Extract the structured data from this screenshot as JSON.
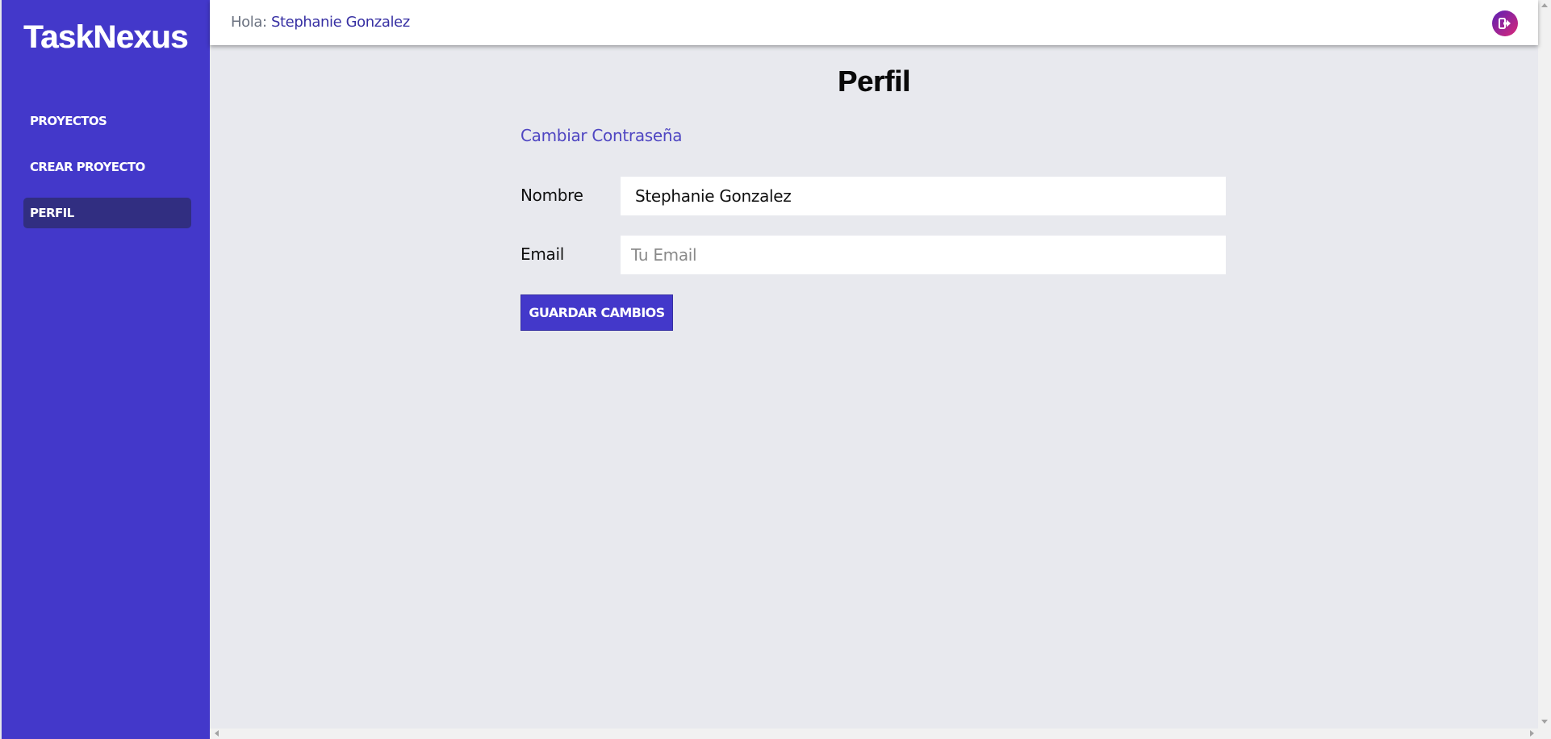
{
  "app": {
    "brand": "TaskNexus"
  },
  "sidebar": {
    "items": [
      {
        "label": "PROYECTOS",
        "active": false
      },
      {
        "label": "CREAR PROYECTO",
        "active": false
      },
      {
        "label": "PERFIL",
        "active": true
      }
    ]
  },
  "header": {
    "greeting_prefix": "Hola: ",
    "user_name": "Stephanie Gonzalez",
    "logout_icon": "logout-icon"
  },
  "main": {
    "title": "Perfil",
    "change_password_link": "Cambiar Contraseña",
    "form": {
      "name_label": "Nombre",
      "name_value": "Stephanie Gonzalez",
      "email_label": "Email",
      "email_value": "",
      "email_placeholder": "Tu Email",
      "save_button": "GUARDAR CAMBIOS"
    }
  },
  "colors": {
    "sidebar_bg": "#4338ca",
    "sidebar_active_bg": "#312e81",
    "main_bg": "#e8e9ee",
    "link": "#4f46c2",
    "user_name": "#3730a3",
    "logout_gradient_start": "#5b21b6",
    "logout_gradient_end": "#db2777"
  }
}
